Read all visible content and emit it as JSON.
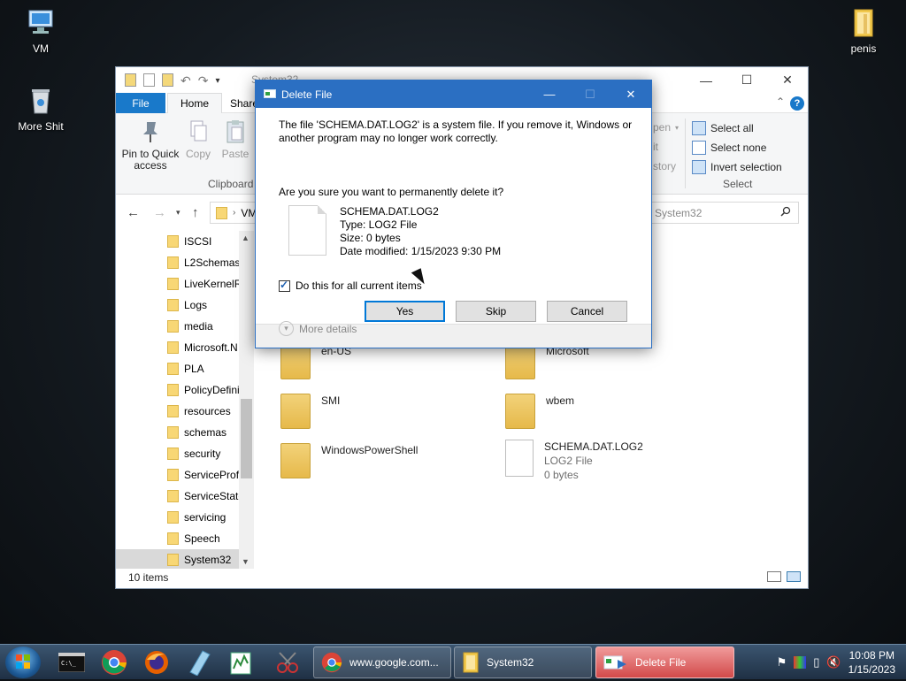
{
  "desktop": {
    "icons": [
      {
        "label": "VM"
      },
      {
        "label": "More Shit"
      },
      {
        "label": "penis"
      }
    ]
  },
  "explorer": {
    "title": "System32",
    "tabs": {
      "file": "File",
      "home": "Home",
      "share": "Share"
    },
    "ribbon": {
      "pin_label_1": "Pin to Quick",
      "pin_label_2": "access",
      "copy_label": "Copy",
      "paste_label": "Paste",
      "clipboard_group": "Clipboard",
      "open_partial": "pen",
      "edit_partial": "it",
      "history_partial": "story",
      "select_all": "Select all",
      "select_none": "Select none",
      "invert_selection": "Invert selection",
      "select_group": "Select"
    },
    "address": {
      "path_partial": "VM"
    },
    "search": {
      "placeholder": "h System32"
    },
    "nav_items": [
      {
        "label": "ISCSI"
      },
      {
        "label": "L2Schemas"
      },
      {
        "label": "LiveKernelR"
      },
      {
        "label": "Logs"
      },
      {
        "label": "media"
      },
      {
        "label": "Microsoft.N"
      },
      {
        "label": "PLA"
      },
      {
        "label": "PolicyDefini"
      },
      {
        "label": "resources"
      },
      {
        "label": "schemas"
      },
      {
        "label": "security"
      },
      {
        "label": "ServiceProfi"
      },
      {
        "label": "ServiceState"
      },
      {
        "label": "servicing"
      },
      {
        "label": "Speech"
      },
      {
        "label": "System32"
      }
    ],
    "content_items": [
      {
        "name": "en-US"
      },
      {
        "name": "Microsoft"
      },
      {
        "name": "SMI"
      },
      {
        "name": "wbem"
      },
      {
        "name": "WindowsPowerShell"
      },
      {
        "name": "SCHEMA.DAT.LOG2",
        "type": "LOG2 File",
        "size": "0 bytes"
      }
    ],
    "status": "10 items"
  },
  "dialog": {
    "title": "Delete File",
    "message": "The file 'SCHEMA.DAT.LOG2' is a system file. If you remove it, Windows or another program may no longer work correctly.",
    "question": "Are you sure you want to permanently delete it?",
    "file": {
      "name": "SCHEMA.DAT.LOG2",
      "type": "Type: LOG2 File",
      "size": "Size: 0 bytes",
      "modified": "Date modified: 1/15/2023 9:30 PM"
    },
    "checkbox_label": "Do this for all current items",
    "checkbox_checked": true,
    "buttons": {
      "yes": "Yes",
      "skip": "Skip",
      "cancel": "Cancel"
    },
    "more_details": "More details"
  },
  "taskbar": {
    "tasks": [
      {
        "label": "www.google.com..."
      },
      {
        "label": "System32"
      },
      {
        "label": "Delete File"
      }
    ],
    "clock": {
      "time": "10:08 PM",
      "date": "1/15/2023"
    }
  },
  "colors": {
    "accent": "#2b6fc2",
    "ribbon_file_tab": "#1979ca",
    "active_task": "#d24a4a"
  }
}
